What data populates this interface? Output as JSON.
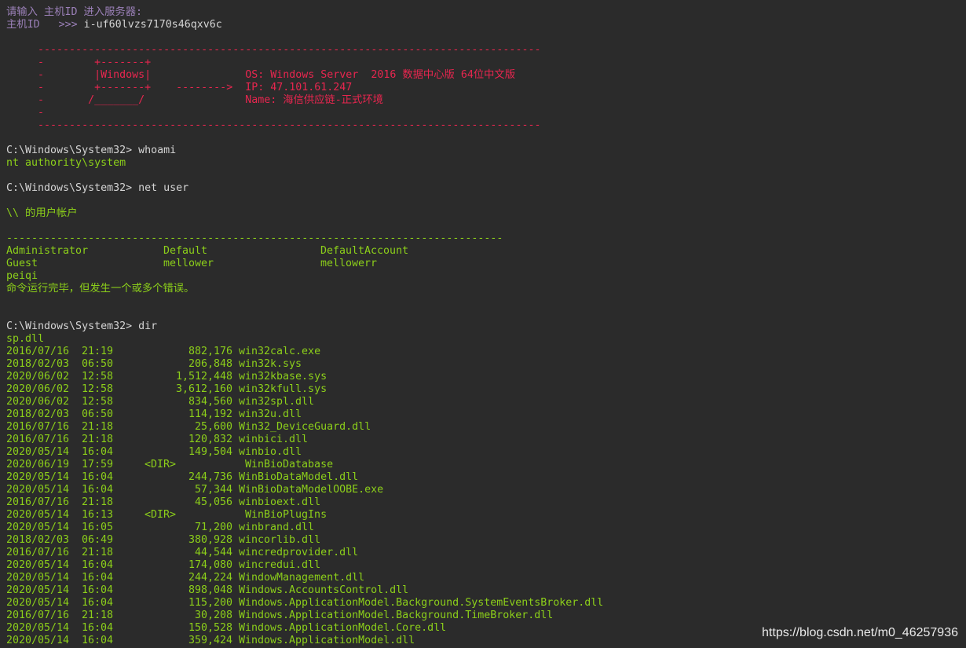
{
  "colors": {
    "background": "#2b2b2b",
    "prompt": "#9b80b8",
    "command": "#d4d4d4",
    "banner": "#e8264f",
    "output": "#8ccf1a"
  },
  "header": {
    "prompt_line": "请输入 主机ID 进入服务器:",
    "host_label": "主机ID   >>> ",
    "host_value": "i-uf60lvzs7170s46qxv6c"
  },
  "banner": [
    "     --------------------------------------------------------------------------------",
    "     -        +-------+",
    "     -        |Windows|               OS: Windows Server  2016 数据中心版 64位中文版",
    "     -        +-------+    -------->  IP: 47.101.61.247",
    "     -       /_______/                Name: 海信供应链-正式环境",
    "     -",
    "     --------------------------------------------------------------------------------"
  ],
  "session": {
    "prompt": "C:\\Windows\\System32> ",
    "cmd1": "whoami",
    "out1": "nt authority\\system",
    "cmd2": "net user",
    "users_title": "\\\\ 的用户帐户",
    "users_rule": "-------------------------------------------------------------------------------",
    "users": [
      [
        "Administrator",
        "Default",
        "DefaultAccount"
      ],
      [
        "Guest",
        "mellower",
        "mellowerr"
      ],
      [
        "peiqi"
      ]
    ],
    "users_status": "命令运行完毕，但发生一个或多个错误。",
    "cmd3": "dir",
    "dir_partial": "sp.dll",
    "dir_rows": [
      [
        "2016/07/16",
        "21:19",
        "882,176",
        "win32calc.exe"
      ],
      [
        "2018/02/03",
        "06:50",
        "206,848",
        "win32k.sys"
      ],
      [
        "2020/06/02",
        "12:58",
        "1,512,448",
        "win32kbase.sys"
      ],
      [
        "2020/06/02",
        "12:58",
        "3,612,160",
        "win32kfull.sys"
      ],
      [
        "2020/06/02",
        "12:58",
        "834,560",
        "win32spl.dll"
      ],
      [
        "2018/02/03",
        "06:50",
        "114,192",
        "win32u.dll"
      ],
      [
        "2016/07/16",
        "21:18",
        "25,600",
        "Win32_DeviceGuard.dll"
      ],
      [
        "2016/07/16",
        "21:18",
        "120,832",
        "winbici.dll"
      ],
      [
        "2020/05/14",
        "16:04",
        "149,504",
        "winbio.dll"
      ],
      [
        "2020/06/19",
        "17:59",
        "<DIR>",
        "WinBioDatabase"
      ],
      [
        "2020/05/14",
        "16:04",
        "244,736",
        "WinBioDataModel.dll"
      ],
      [
        "2020/05/14",
        "16:04",
        "57,344",
        "WinBioDataModelOOBE.exe"
      ],
      [
        "2016/07/16",
        "21:18",
        "45,056",
        "winbioext.dll"
      ],
      [
        "2020/05/14",
        "16:13",
        "<DIR>",
        "WinBioPlugIns"
      ],
      [
        "2020/05/14",
        "16:05",
        "71,200",
        "winbrand.dll"
      ],
      [
        "2018/02/03",
        "06:49",
        "380,928",
        "wincorlib.dll"
      ],
      [
        "2016/07/16",
        "21:18",
        "44,544",
        "wincredprovider.dll"
      ],
      [
        "2020/05/14",
        "16:04",
        "174,080",
        "wincredui.dll"
      ],
      [
        "2020/05/14",
        "16:04",
        "244,224",
        "WindowManagement.dll"
      ],
      [
        "2020/05/14",
        "16:04",
        "898,048",
        "Windows.AccountsControl.dll"
      ],
      [
        "2020/05/14",
        "16:04",
        "115,200",
        "Windows.ApplicationModel.Background.SystemEventsBroker.dll"
      ],
      [
        "2016/07/16",
        "21:18",
        "30,208",
        "Windows.ApplicationModel.Background.TimeBroker.dll"
      ],
      [
        "2020/05/14",
        "16:04",
        "150,528",
        "Windows.ApplicationModel.Core.dll"
      ],
      [
        "2020/05/14",
        "16:04",
        "359,424",
        "Windows.ApplicationModel.dll"
      ]
    ]
  },
  "watermark": "https://blog.csdn.net/m0_46257936"
}
